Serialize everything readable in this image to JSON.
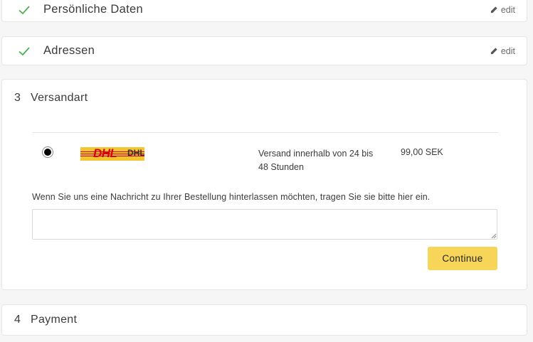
{
  "steps": {
    "personal": {
      "title": "Persönliche Daten",
      "edit_label": "edit"
    },
    "addresses": {
      "title": "Adressen",
      "edit_label": "edit"
    },
    "shipping": {
      "number": "3",
      "title": "Versandart",
      "carrier": {
        "logo_text": "DHL",
        "logo_alt": "DHL",
        "delivery_time": "Versand innerhalb von 24 bis 48 Stunden",
        "price": "99,00 SEK",
        "selected": true
      },
      "message_label": "Wenn Sie uns eine Nachricht zu Ihrer Bestellung hinterlassen möchten, tragen Sie sie bitte hier ein.",
      "message_value": "",
      "continue_label": "Continue"
    },
    "payment": {
      "number": "4",
      "title": "Payment"
    }
  },
  "colors": {
    "check": "#4caf50",
    "continue_button": "#f7d558",
    "dhl_yellow": "#f5c431",
    "dhl_red": "#d40511"
  },
  "icons": {
    "check": "check-icon",
    "edit": "pencil-icon",
    "resize": "resize-grip-icon"
  }
}
